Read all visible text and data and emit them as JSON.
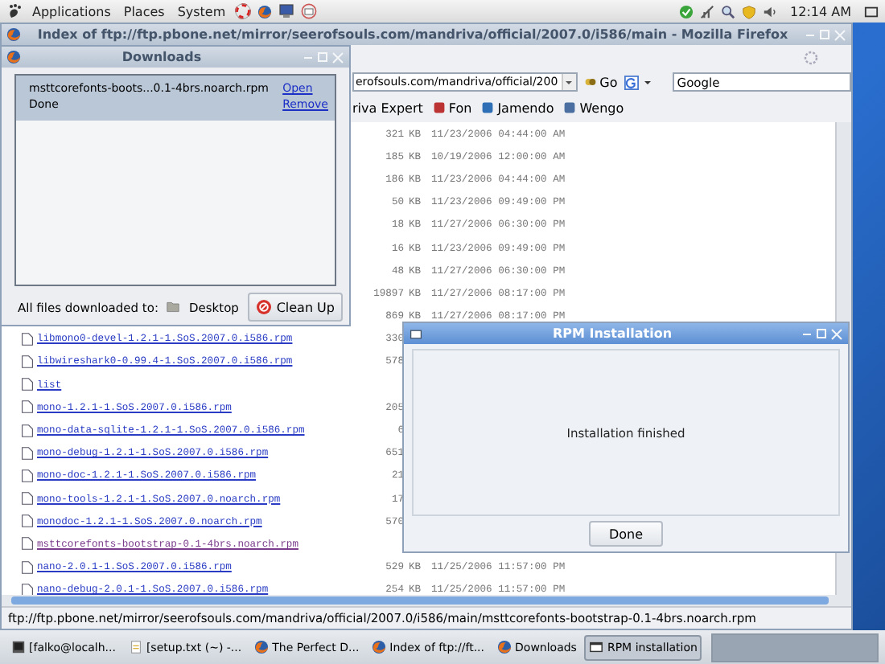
{
  "top_panel": {
    "menus": [
      "Applications",
      "Places",
      "System"
    ],
    "clock": "12:14 AM"
  },
  "browser": {
    "title": "Index of ftp://ftp.pbone.net/mirror/seerofsouls.com/mandriva/official/2007.0/i586/main - Mozilla Firefox",
    "address": "erofsouls.com/mandriva/official/200",
    "go_label": "Go",
    "search_value": "Google",
    "bookmarks": [
      "riva Expert",
      "Fon",
      "Jamendo",
      "Wengo"
    ],
    "listing": [
      {
        "size": "321",
        "unit": "KB",
        "date": "11/23/2006 04:44:00 AM"
      },
      {
        "size": "185",
        "unit": "KB",
        "date": "10/19/2006 12:00:00 AM"
      },
      {
        "size": "186",
        "unit": "KB",
        "date": "11/23/2006 04:44:00 AM"
      },
      {
        "size": "50",
        "unit": "KB",
        "date": "11/23/2006 09:49:00 PM"
      },
      {
        "size": "18",
        "unit": "KB",
        "date": "11/27/2006 06:30:00 PM"
      },
      {
        "size": "16",
        "unit": "KB",
        "date": "11/23/2006 09:49:00 PM"
      },
      {
        "size": "48",
        "unit": "KB",
        "date": "11/27/2006 06:30:00 PM"
      },
      {
        "size": "19897",
        "unit": "KB",
        "date": "11/27/2006 08:17:00 PM"
      },
      {
        "size": "869",
        "unit": "KB",
        "date": "11/27/2006 08:17:00 PM"
      },
      {
        "name": "libmono0-devel-1.2.1-1.SoS.2007.0.i586.rpm",
        "visited": false,
        "size": "330"
      },
      {
        "name": "libwireshark0-0.99.4-1.SoS.2007.0.i586.rpm",
        "visited": false,
        "size": "578"
      },
      {
        "name": "list",
        "visited": false
      },
      {
        "name": "mono-1.2.1-1.SoS.2007.0.i586.rpm",
        "visited": false,
        "size": "205"
      },
      {
        "name": "mono-data-sqlite-1.2.1-1.SoS.2007.0.i586.rpm",
        "visited": false,
        "size": "6"
      },
      {
        "name": "mono-debug-1.2.1-1.SoS.2007.0.i586.rpm",
        "visited": false,
        "size": "651"
      },
      {
        "name": "mono-doc-1.2.1-1.SoS.2007.0.i586.rpm",
        "visited": false,
        "size": "21"
      },
      {
        "name": "mono-tools-1.2.1-1.SoS.2007.0.noarch.rpm",
        "visited": false,
        "size": "17"
      },
      {
        "name": "monodoc-1.2.1-1.SoS.2007.0.noarch.rpm",
        "visited": false,
        "size": "570"
      },
      {
        "name": "msttcorefonts-bootstrap-0.1-4brs.noarch.rpm",
        "visited": true
      },
      {
        "name": "nano-2.0.1-1.SoS.2007.0.i586.rpm",
        "visited": false,
        "size": "529",
        "unit": "KB",
        "date": "11/25/2006 11:57:00 PM"
      },
      {
        "name": "nano-debug-2.0.1-1.SoS.2007.0.i586.rpm",
        "visited": false,
        "size": "254",
        "unit": "KB",
        "date": "11/25/2006 11:57:00 PM"
      }
    ],
    "status": "ftp://ftp.pbone.net/mirror/seerofsouls.com/mandriva/official/2007.0/i586/main/msttcorefonts-bootstrap-0.1-4brs.noarch.rpm"
  },
  "downloads": {
    "title": "Downloads",
    "items": [
      {
        "file": "msttcorefonts-boots...0.1-4brs.noarch.rpm",
        "status": "Done",
        "actions": [
          "Open",
          "Remove"
        ],
        "selected": true
      }
    ],
    "save_label": "All files downloaded to:",
    "folder": "Desktop",
    "cleanup_label": "Clean Up"
  },
  "rpm_dialog": {
    "title": "RPM Installation",
    "message": "Installation finished",
    "button": "Done"
  },
  "taskbar": [
    {
      "kind": "terminal",
      "label": "[falko@localh...",
      "selected": false
    },
    {
      "kind": "editor",
      "label": "[setup.txt (~) -...",
      "selected": false
    },
    {
      "kind": "browser",
      "label": "The Perfect D...",
      "selected": false
    },
    {
      "kind": "browser",
      "label": "Index of ftp://ft...",
      "selected": false
    },
    {
      "kind": "browser",
      "label": "Downloads",
      "selected": false
    },
    {
      "kind": "window",
      "label": "RPM installation",
      "selected": true
    }
  ]
}
